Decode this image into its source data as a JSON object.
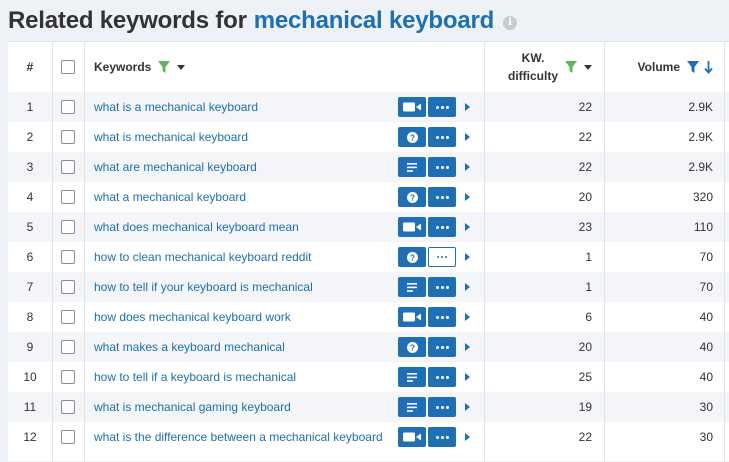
{
  "title": {
    "prefix": "Related keywords for",
    "query": "mechanical keyboard",
    "info_glyph": "i"
  },
  "header": {
    "num": "#",
    "keywords": "Keywords",
    "kd_line1": "KW.",
    "kd_line2": "difficulty",
    "volume": "Volume"
  },
  "colors": {
    "accent": "#1e6fb3",
    "filter_green": "#5cb85c",
    "row_alt": "#f3f5f9"
  },
  "rows": [
    {
      "num": "1",
      "keyword": "what is a mechanical keyboard",
      "type": "video-icon",
      "kd": "22",
      "volume": "2.9K"
    },
    {
      "num": "2",
      "keyword": "what is mechanical keyboard",
      "type": "question-icon",
      "kd": "22",
      "volume": "2.9K"
    },
    {
      "num": "3",
      "keyword": "what are mechanical keyboard",
      "type": "text-icon",
      "kd": "22",
      "volume": "2.9K"
    },
    {
      "num": "4",
      "keyword": "what a mechanical keyboard",
      "type": "question-icon",
      "kd": "20",
      "volume": "320"
    },
    {
      "num": "5",
      "keyword": "what does mechanical keyboard mean",
      "type": "video-icon",
      "kd": "23",
      "volume": "110"
    },
    {
      "num": "6",
      "keyword": "how to clean mechanical keyboard reddit",
      "type": "question-icon",
      "kd": "1",
      "volume": "70"
    },
    {
      "num": "7",
      "keyword": "how to tell if your keyboard is mechanical",
      "type": "text-icon",
      "kd": "1",
      "volume": "70"
    },
    {
      "num": "8",
      "keyword": "how does mechanical keyboard work",
      "type": "video-icon",
      "kd": "6",
      "volume": "40"
    },
    {
      "num": "9",
      "keyword": "what makes a keyboard mechanical",
      "type": "question-icon",
      "kd": "20",
      "volume": "40"
    },
    {
      "num": "10",
      "keyword": "how to tell if a keyboard is mechanical",
      "type": "text-icon",
      "kd": "25",
      "volume": "40"
    },
    {
      "num": "11",
      "keyword": "what is mechanical gaming keyboard",
      "type": "text-icon",
      "kd": "19",
      "volume": "30"
    },
    {
      "num": "12",
      "keyword": "what is the difference between a mechanical keyboard",
      "type": "video-icon",
      "kd": "22",
      "volume": "30"
    }
  ]
}
